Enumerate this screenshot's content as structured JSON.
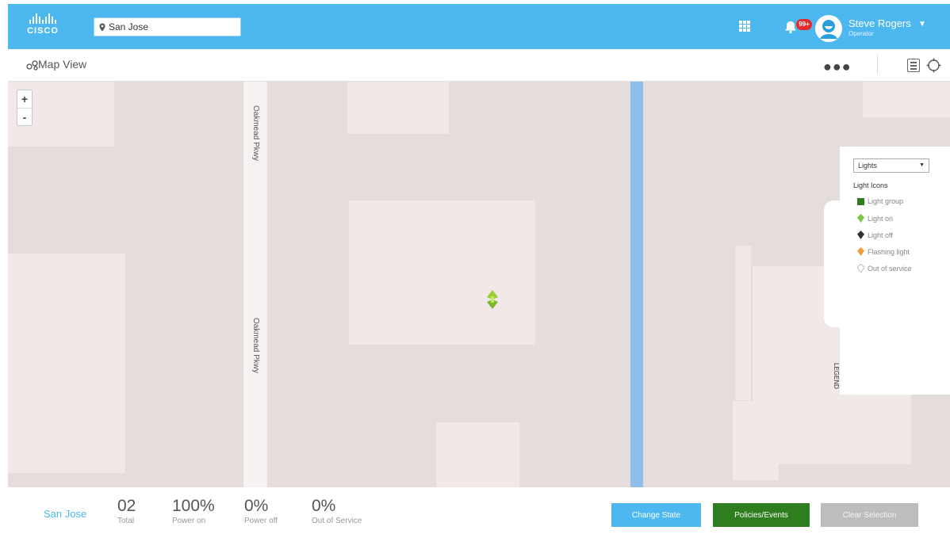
{
  "header": {
    "brand": "CISCO",
    "search_value": "San Jose",
    "notification_count": "99+",
    "user_name": "Steve Rogers",
    "user_role": "Operator",
    "accent_color": "#4db8ef"
  },
  "subheader": {
    "title": "Map View"
  },
  "map": {
    "zoom_in_label": "+",
    "zoom_out_label": "-",
    "street_label_upper": "Oakmead Pkwy",
    "street_label_lower": "Oakmead Pkwy",
    "legend": {
      "selected_layer": "Lights",
      "title": "Light Icons",
      "tab_label": "LEGEND",
      "items": [
        {
          "label": "Light group",
          "icon": "light-group-icon",
          "color": "#2e7d1f"
        },
        {
          "label": "Light on",
          "icon": "light-on-icon",
          "color": "#7ac943"
        },
        {
          "label": "Light off",
          "icon": "light-off-icon",
          "color": "#333333"
        },
        {
          "label": "Flashing light",
          "icon": "flashing-light-icon",
          "color": "#f39c3c"
        },
        {
          "label": "Out of service",
          "icon": "out-of-service-icon",
          "color": "#bbbbbb"
        }
      ]
    }
  },
  "footer": {
    "location": "San Jose",
    "stats": [
      {
        "value": "02",
        "label": "Total"
      },
      {
        "value": "100%",
        "label": "Power on"
      },
      {
        "value": "0%",
        "label": "Power off"
      },
      {
        "value": "0%",
        "label": "Out of Service"
      }
    ],
    "buttons": {
      "change_state": "Change State",
      "policies_events": "Policies/Events",
      "clear_selection": "Clear Selection"
    }
  }
}
